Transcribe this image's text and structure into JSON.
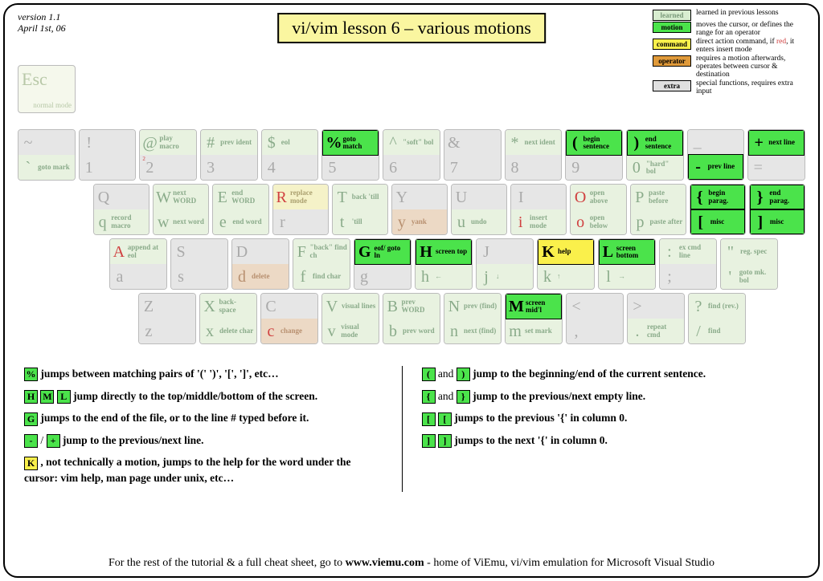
{
  "version_line1": "version 1.1",
  "version_line2": "April 1st, 06",
  "title": "vi/vim lesson 6 – various motions",
  "legend": {
    "learned": {
      "label": "learned",
      "desc": "learned in previous lessons"
    },
    "motion": {
      "label": "motion",
      "desc": "moves the cursor, or defines the range for an operator"
    },
    "command": {
      "label": "command",
      "desc": "direct action command, if red, it enters insert mode"
    },
    "operator": {
      "label": "operator",
      "desc": "requires a motion afterwards, operates between cursor & destination"
    },
    "extra": {
      "label": "extra",
      "desc": "special functions, requires extra input"
    }
  },
  "esc": {
    "big": "Esc",
    "small": "normal mode"
  },
  "row1": [
    {
      "top": {
        "ch": "~",
        "cls": "gray"
      },
      "bot": {
        "ch": "`",
        "lbl": "goto mark",
        "cls": "learned"
      }
    },
    {
      "top": {
        "ch": "!",
        "cls": "gray"
      },
      "bot": {
        "ch": "1",
        "cls": "gray"
      }
    },
    {
      "top": {
        "ch": "@",
        "lbl": "play macro",
        "cls": "learned"
      },
      "bot": {
        "ch": "2",
        "cls": "gray",
        "sup": "2"
      }
    },
    {
      "top": {
        "ch": "#",
        "lbl": "prev ident",
        "cls": "learned"
      },
      "bot": {
        "ch": "3",
        "cls": "gray"
      }
    },
    {
      "top": {
        "ch": "$",
        "lbl": "eol",
        "cls": "learned"
      },
      "bot": {
        "ch": "4",
        "cls": "gray"
      }
    },
    {
      "top": {
        "ch": "%",
        "lbl": "goto match",
        "cls": "motion"
      },
      "bot": {
        "ch": "5",
        "cls": "gray"
      }
    },
    {
      "top": {
        "ch": "^",
        "lbl": "\"soft\" bol",
        "cls": "learned"
      },
      "bot": {
        "ch": "6",
        "cls": "gray"
      }
    },
    {
      "top": {
        "ch": "&",
        "cls": "gray"
      },
      "bot": {
        "ch": "7",
        "cls": "gray"
      }
    },
    {
      "top": {
        "ch": "*",
        "lbl": "next ident",
        "cls": "learned"
      },
      "bot": {
        "ch": "8",
        "cls": "gray"
      }
    },
    {
      "top": {
        "ch": "(",
        "lbl": "begin sentence",
        "cls": "motion"
      },
      "bot": {
        "ch": "9",
        "cls": "gray"
      }
    },
    {
      "top": {
        "ch": ")",
        "lbl": "end sentence",
        "cls": "motion"
      },
      "bot": {
        "ch": "0",
        "lbl": "\"hard\" bol",
        "cls": "learned"
      }
    },
    {
      "top": {
        "ch": "_",
        "cls": "gray"
      },
      "bot": {
        "ch": "-",
        "lbl": "prev line",
        "cls": "motion"
      }
    },
    {
      "top": {
        "ch": "+",
        "lbl": "next line",
        "cls": "motion"
      },
      "bot": {
        "ch": "=",
        "cls": "gray"
      }
    }
  ],
  "row2": [
    {
      "top": {
        "ch": "Q",
        "cls": "gray"
      },
      "bot": {
        "ch": "q",
        "lbl": "record macro",
        "cls": "learned"
      }
    },
    {
      "top": {
        "ch": "W",
        "lbl": "next WORD",
        "cls": "learned"
      },
      "bot": {
        "ch": "w",
        "lbl": "next word",
        "cls": "learned"
      }
    },
    {
      "top": {
        "ch": "E",
        "lbl": "end WORD",
        "cls": "learned"
      },
      "bot": {
        "ch": "e",
        "lbl": "end word",
        "cls": "learned"
      }
    },
    {
      "top": {
        "ch": "R",
        "lbl": "replace mode",
        "cls": "learned cmd",
        "red": true
      },
      "bot": {
        "ch": "r",
        "cls": "gray"
      }
    },
    {
      "top": {
        "ch": "T",
        "lbl": "back 'till",
        "cls": "learned"
      },
      "bot": {
        "ch": "t",
        "lbl": "'till",
        "cls": "learned"
      }
    },
    {
      "top": {
        "ch": "Y",
        "cls": "gray"
      },
      "bot": {
        "ch": "y",
        "lbl": "yank",
        "cls": "learned op"
      }
    },
    {
      "top": {
        "ch": "U",
        "cls": "gray"
      },
      "bot": {
        "ch": "u",
        "lbl": "undo",
        "cls": "learned"
      }
    },
    {
      "top": {
        "ch": "I",
        "cls": "gray"
      },
      "bot": {
        "ch": "i",
        "lbl": "insert mode",
        "cls": "learned",
        "red": true
      }
    },
    {
      "top": {
        "ch": "O",
        "lbl": "open above",
        "cls": "learned",
        "red": true
      },
      "bot": {
        "ch": "o",
        "lbl": "open below",
        "cls": "learned",
        "red": true
      }
    },
    {
      "top": {
        "ch": "P",
        "lbl": "paste before",
        "cls": "learned"
      },
      "bot": {
        "ch": "p",
        "lbl": "paste after",
        "cls": "learned"
      }
    },
    {
      "top": {
        "ch": "{",
        "lbl": "begin parag.",
        "cls": "motion"
      },
      "bot": {
        "ch": "[",
        "lbl": "misc",
        "cls": "motion"
      }
    },
    {
      "top": {
        "ch": "}",
        "lbl": "end parag.",
        "cls": "motion"
      },
      "bot": {
        "ch": "]",
        "lbl": "misc",
        "cls": "motion"
      }
    }
  ],
  "row3": [
    {
      "top": {
        "ch": "A",
        "lbl": "append at eol",
        "cls": "learned",
        "red": true
      },
      "bot": {
        "ch": "a",
        "cls": "gray"
      }
    },
    {
      "top": {
        "ch": "S",
        "cls": "gray"
      },
      "bot": {
        "ch": "s",
        "cls": "gray"
      }
    },
    {
      "top": {
        "ch": "D",
        "cls": "gray"
      },
      "bot": {
        "ch": "d",
        "lbl": "delete",
        "cls": "learned op"
      }
    },
    {
      "top": {
        "ch": "F",
        "lbl": "\"back\" find ch",
        "cls": "learned"
      },
      "bot": {
        "ch": "f",
        "lbl": "find char",
        "cls": "learned"
      }
    },
    {
      "top": {
        "ch": "G",
        "lbl": "eof/ goto ln",
        "cls": "motion"
      },
      "bot": {
        "ch": "g",
        "cls": "gray"
      }
    },
    {
      "top": {
        "ch": "H",
        "lbl": "screen top",
        "cls": "motion"
      },
      "bot": {
        "ch": "h",
        "lbl": "←",
        "cls": "learned"
      }
    },
    {
      "top": {
        "ch": "J",
        "cls": "gray"
      },
      "bot": {
        "ch": "j",
        "lbl": "↓",
        "cls": "learned"
      }
    },
    {
      "top": {
        "ch": "K",
        "lbl": "help",
        "cls": "command"
      },
      "bot": {
        "ch": "k",
        "lbl": "↑",
        "cls": "learned"
      }
    },
    {
      "top": {
        "ch": "L",
        "lbl": "screen bottom",
        "cls": "motion"
      },
      "bot": {
        "ch": "l",
        "lbl": "→",
        "cls": "learned"
      }
    },
    {
      "top": {
        "ch": ":",
        "lbl": "ex cmd line",
        "cls": "learned"
      },
      "bot": {
        "ch": ";",
        "cls": "gray"
      }
    },
    {
      "top": {
        "ch": "\"",
        "lbl": "reg. spec",
        "cls": "learned"
      },
      "bot": {
        "ch": "'",
        "lbl": "goto mk. bol",
        "cls": "learned"
      }
    }
  ],
  "row4": [
    {
      "top": {
        "ch": "Z",
        "cls": "gray"
      },
      "bot": {
        "ch": "z",
        "cls": "gray"
      }
    },
    {
      "top": {
        "ch": "X",
        "lbl": "back- space",
        "cls": "learned"
      },
      "bot": {
        "ch": "x",
        "lbl": "delete char",
        "cls": "learned"
      }
    },
    {
      "top": {
        "ch": "C",
        "cls": "gray"
      },
      "bot": {
        "ch": "c",
        "lbl": "change",
        "cls": "learned op",
        "red": true
      }
    },
    {
      "top": {
        "ch": "V",
        "lbl": "visual lines",
        "cls": "learned"
      },
      "bot": {
        "ch": "v",
        "lbl": "visual mode",
        "cls": "learned"
      }
    },
    {
      "top": {
        "ch": "B",
        "lbl": "prev WORD",
        "cls": "learned"
      },
      "bot": {
        "ch": "b",
        "lbl": "prev word",
        "cls": "learned"
      }
    },
    {
      "top": {
        "ch": "N",
        "lbl": "prev (find)",
        "cls": "learned"
      },
      "bot": {
        "ch": "n",
        "lbl": "next (find)",
        "cls": "learned"
      }
    },
    {
      "top": {
        "ch": "M",
        "lbl": "screen mid'l",
        "cls": "motion"
      },
      "bot": {
        "ch": "m",
        "lbl": "set mark",
        "cls": "learned"
      }
    },
    {
      "top": {
        "ch": "<",
        "cls": "gray"
      },
      "bot": {
        "ch": ",",
        "cls": "gray"
      }
    },
    {
      "top": {
        "ch": ">",
        "cls": "gray"
      },
      "bot": {
        "ch": ".",
        "lbl": "repeat cmd",
        "cls": "learned"
      }
    },
    {
      "top": {
        "ch": "?",
        "lbl": "find (rev.)",
        "cls": "learned"
      },
      "bot": {
        "ch": "/",
        "lbl": "find",
        "cls": "learned"
      }
    }
  ],
  "tips_left": [
    {
      "k": [
        {
          "t": "%",
          "c": "m"
        }
      ],
      "txt": " jumps between matching pairs of '(' ')', '[', ']',  etc…"
    },
    {
      "k": [
        {
          "t": "H",
          "c": "m"
        },
        {
          "t": "M",
          "c": "m"
        },
        {
          "t": "L",
          "c": "m"
        }
      ],
      "txt": " jump directly to the top/middle/bottom of the screen."
    },
    {
      "k": [
        {
          "t": "G",
          "c": "m"
        }
      ],
      "txt": " jumps to the end of the file, or to the line # typed before it."
    },
    {
      "k": [
        {
          "t": "-",
          "c": "m"
        }
      ],
      "mid": " / ",
      "k2": [
        {
          "t": "+",
          "c": "m"
        }
      ],
      "txt": " jump to the previous/next line."
    },
    {
      "k": [
        {
          "t": "K",
          "c": "c"
        }
      ],
      "txt": ", not technically a motion, jumps to the help for the word under the cursor: vim help, man page under unix, etc…"
    }
  ],
  "tips_right": [
    {
      "k": [
        {
          "t": "(",
          "c": "m"
        }
      ],
      "mid": " and ",
      "k2": [
        {
          "t": ")",
          "c": "m"
        }
      ],
      "txt": " jump to the beginning/end of the current sentence."
    },
    {
      "k": [
        {
          "t": "{",
          "c": "m"
        }
      ],
      "mid": " and ",
      "k2": [
        {
          "t": "}",
          "c": "m"
        }
      ],
      "txt": " jump to the previous/next empty line."
    },
    {
      "k": [
        {
          "t": "[",
          "c": "m"
        },
        {
          "t": "[",
          "c": "m"
        }
      ],
      "txt": " jumps to the previous '{' in column 0."
    },
    {
      "k": [
        {
          "t": "]",
          "c": "m"
        },
        {
          "t": "]",
          "c": "m"
        }
      ],
      "txt": " jumps to the next '{' in column 0."
    }
  ],
  "footer_pre": "For the rest of the tutorial & a full cheat sheet, go to ",
  "footer_url": "www.viemu.com",
  "footer_post": " - home of ViEmu, vi/vim emulation for Microsoft Visual Studio"
}
